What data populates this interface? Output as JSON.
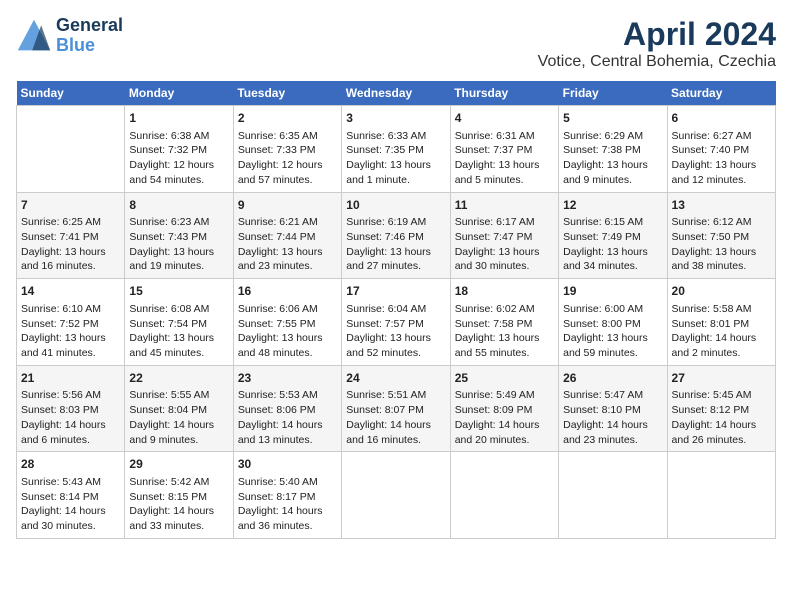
{
  "header": {
    "logo_line1": "General",
    "logo_line2": "Blue",
    "title": "April 2024",
    "subtitle": "Votice, Central Bohemia, Czechia"
  },
  "days_of_week": [
    "Sunday",
    "Monday",
    "Tuesday",
    "Wednesday",
    "Thursday",
    "Friday",
    "Saturday"
  ],
  "weeks": [
    [
      {
        "day": "",
        "content": ""
      },
      {
        "day": "1",
        "content": "Sunrise: 6:38 AM\nSunset: 7:32 PM\nDaylight: 12 hours\nand 54 minutes."
      },
      {
        "day": "2",
        "content": "Sunrise: 6:35 AM\nSunset: 7:33 PM\nDaylight: 12 hours\nand 57 minutes."
      },
      {
        "day": "3",
        "content": "Sunrise: 6:33 AM\nSunset: 7:35 PM\nDaylight: 13 hours\nand 1 minute."
      },
      {
        "day": "4",
        "content": "Sunrise: 6:31 AM\nSunset: 7:37 PM\nDaylight: 13 hours\nand 5 minutes."
      },
      {
        "day": "5",
        "content": "Sunrise: 6:29 AM\nSunset: 7:38 PM\nDaylight: 13 hours\nand 9 minutes."
      },
      {
        "day": "6",
        "content": "Sunrise: 6:27 AM\nSunset: 7:40 PM\nDaylight: 13 hours\nand 12 minutes."
      }
    ],
    [
      {
        "day": "7",
        "content": "Sunrise: 6:25 AM\nSunset: 7:41 PM\nDaylight: 13 hours\nand 16 minutes."
      },
      {
        "day": "8",
        "content": "Sunrise: 6:23 AM\nSunset: 7:43 PM\nDaylight: 13 hours\nand 19 minutes."
      },
      {
        "day": "9",
        "content": "Sunrise: 6:21 AM\nSunset: 7:44 PM\nDaylight: 13 hours\nand 23 minutes."
      },
      {
        "day": "10",
        "content": "Sunrise: 6:19 AM\nSunset: 7:46 PM\nDaylight: 13 hours\nand 27 minutes."
      },
      {
        "day": "11",
        "content": "Sunrise: 6:17 AM\nSunset: 7:47 PM\nDaylight: 13 hours\nand 30 minutes."
      },
      {
        "day": "12",
        "content": "Sunrise: 6:15 AM\nSunset: 7:49 PM\nDaylight: 13 hours\nand 34 minutes."
      },
      {
        "day": "13",
        "content": "Sunrise: 6:12 AM\nSunset: 7:50 PM\nDaylight: 13 hours\nand 38 minutes."
      }
    ],
    [
      {
        "day": "14",
        "content": "Sunrise: 6:10 AM\nSunset: 7:52 PM\nDaylight: 13 hours\nand 41 minutes."
      },
      {
        "day": "15",
        "content": "Sunrise: 6:08 AM\nSunset: 7:54 PM\nDaylight: 13 hours\nand 45 minutes."
      },
      {
        "day": "16",
        "content": "Sunrise: 6:06 AM\nSunset: 7:55 PM\nDaylight: 13 hours\nand 48 minutes."
      },
      {
        "day": "17",
        "content": "Sunrise: 6:04 AM\nSunset: 7:57 PM\nDaylight: 13 hours\nand 52 minutes."
      },
      {
        "day": "18",
        "content": "Sunrise: 6:02 AM\nSunset: 7:58 PM\nDaylight: 13 hours\nand 55 minutes."
      },
      {
        "day": "19",
        "content": "Sunrise: 6:00 AM\nSunset: 8:00 PM\nDaylight: 13 hours\nand 59 minutes."
      },
      {
        "day": "20",
        "content": "Sunrise: 5:58 AM\nSunset: 8:01 PM\nDaylight: 14 hours\nand 2 minutes."
      }
    ],
    [
      {
        "day": "21",
        "content": "Sunrise: 5:56 AM\nSunset: 8:03 PM\nDaylight: 14 hours\nand 6 minutes."
      },
      {
        "day": "22",
        "content": "Sunrise: 5:55 AM\nSunset: 8:04 PM\nDaylight: 14 hours\nand 9 minutes."
      },
      {
        "day": "23",
        "content": "Sunrise: 5:53 AM\nSunset: 8:06 PM\nDaylight: 14 hours\nand 13 minutes."
      },
      {
        "day": "24",
        "content": "Sunrise: 5:51 AM\nSunset: 8:07 PM\nDaylight: 14 hours\nand 16 minutes."
      },
      {
        "day": "25",
        "content": "Sunrise: 5:49 AM\nSunset: 8:09 PM\nDaylight: 14 hours\nand 20 minutes."
      },
      {
        "day": "26",
        "content": "Sunrise: 5:47 AM\nSunset: 8:10 PM\nDaylight: 14 hours\nand 23 minutes."
      },
      {
        "day": "27",
        "content": "Sunrise: 5:45 AM\nSunset: 8:12 PM\nDaylight: 14 hours\nand 26 minutes."
      }
    ],
    [
      {
        "day": "28",
        "content": "Sunrise: 5:43 AM\nSunset: 8:14 PM\nDaylight: 14 hours\nand 30 minutes."
      },
      {
        "day": "29",
        "content": "Sunrise: 5:42 AM\nSunset: 8:15 PM\nDaylight: 14 hours\nand 33 minutes."
      },
      {
        "day": "30",
        "content": "Sunrise: 5:40 AM\nSunset: 8:17 PM\nDaylight: 14 hours\nand 36 minutes."
      },
      {
        "day": "",
        "content": ""
      },
      {
        "day": "",
        "content": ""
      },
      {
        "day": "",
        "content": ""
      },
      {
        "day": "",
        "content": ""
      }
    ]
  ]
}
